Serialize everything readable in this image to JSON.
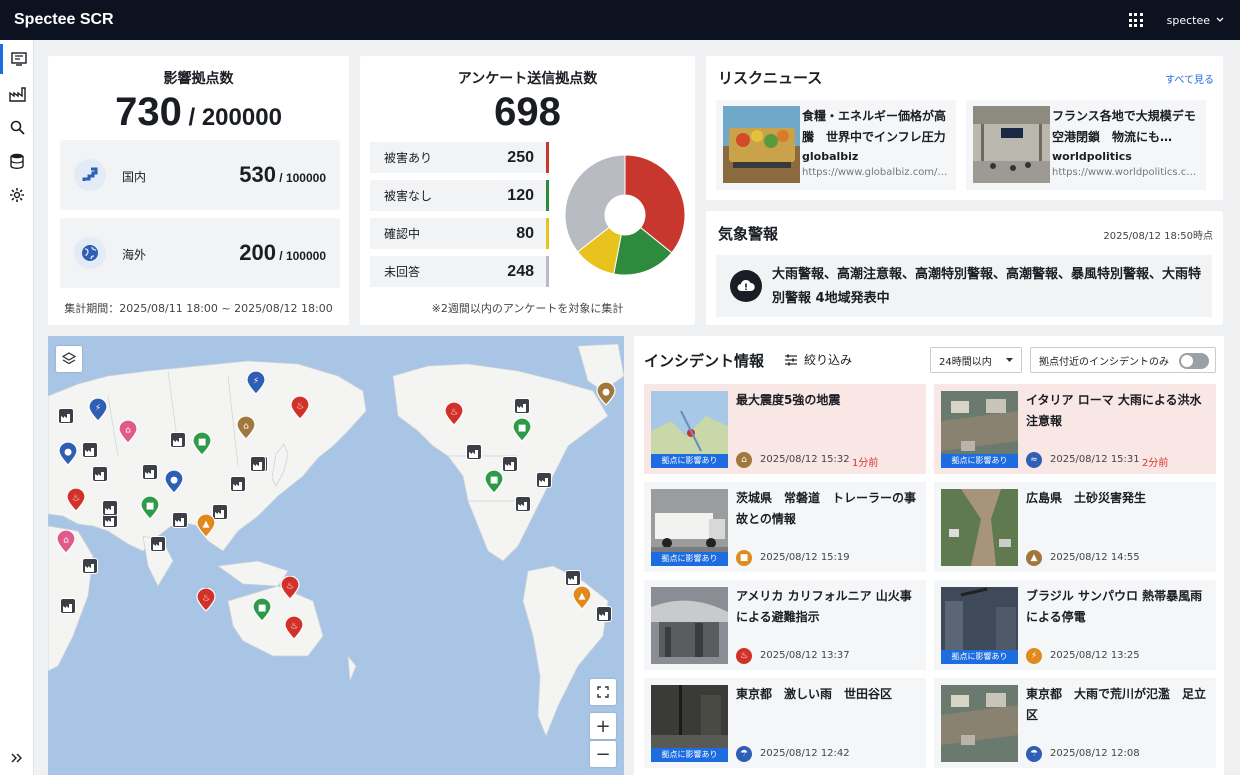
{
  "app": {
    "title": "Spectee SCR",
    "user": "spectee"
  },
  "sidebar": {
    "items": [
      {
        "name": "dashboard",
        "icon": "dashboard-icon"
      },
      {
        "name": "facilities",
        "icon": "factory-icon"
      },
      {
        "name": "search",
        "icon": "search-icon"
      },
      {
        "name": "database",
        "icon": "database-icon"
      },
      {
        "name": "settings",
        "icon": "gear-icon"
      }
    ],
    "expand_icon": "double-chevron-right-icon"
  },
  "impact": {
    "title": "影響拠点数",
    "count": "730",
    "total": " / 200000",
    "domestic": {
      "label": "国内",
      "value": "530",
      "total": " / 100000"
    },
    "overseas": {
      "label": "海外",
      "value": "200",
      "total": " / 100000"
    },
    "period": "集計期間：2025/08/11 18:00 ~ 2025/08/12 18:00"
  },
  "survey": {
    "title": "アンケート送信拠点数",
    "count": "698",
    "rows": [
      {
        "label": "被害あり",
        "value": "250",
        "color": "#c8372d"
      },
      {
        "label": "被害なし",
        "value": "120",
        "color": "#2e8b3e"
      },
      {
        "label": "確認中",
        "value": "80",
        "color": "#e8c21d"
      },
      {
        "label": "未回答",
        "value": "248",
        "color": "#b8bcc2"
      }
    ],
    "note": "※2週間以内のアンケートを対象に集計"
  },
  "risk_news": {
    "title": "リスクニュース",
    "see_all": "すべて見る",
    "items": [
      {
        "title": "食糧・エネルギー価格が高騰　世界中でインフレ圧力",
        "source": "globalbiz",
        "url": "https://www.globalbiz.com/news/inflation"
      },
      {
        "title": "フランス各地で大規模デモ　空港閉鎖　物流にも…",
        "source": "worldpolitics",
        "url": "https://www.worldpolitics.com/france"
      }
    ]
  },
  "weather": {
    "title": "気象警報",
    "timestamp": "2025/08/12 18:50時点",
    "alert": "大雨警報、高潮注意報、高潮特別警報、高潮警報、暴風特別警報、大雨特別警報 4地域発表中",
    "icon": "exclamation-cloud-icon"
  },
  "incidents": {
    "title": "インシデント情報",
    "filter_label": "絞り込み",
    "range": "24時間以内",
    "nearby_only": "拠点付近のインシデントのみ",
    "badge": "拠点に影響あり",
    "items": [
      {
        "title": "最大震度5強の地震",
        "time": "2025/08/12 15:32",
        "ago": "1分前",
        "icon": "house-icon",
        "icon_color": "#a0783c",
        "badge": true,
        "highlight": true
      },
      {
        "title": "イタリア ローマ 大雨による洪水注意報",
        "time": "2025/08/12 15:31",
        "ago": "2分前",
        "icon": "flood-icon",
        "icon_color": "#2f5fb5",
        "badge": true,
        "highlight": true
      },
      {
        "title": "茨城県　常磐道　トレーラーの事故との情報",
        "time": "2025/08/12 15:19",
        "ago": "",
        "icon": "accident-icon",
        "icon_color": "#e08a1e",
        "badge": true,
        "highlight": false
      },
      {
        "title": "広島県　土砂災害発生",
        "time": "2025/08/12 14:55",
        "ago": "",
        "icon": "landslide-icon",
        "icon_color": "#a0783c",
        "badge": false,
        "highlight": false
      },
      {
        "title": "アメリカ カリフォルニア 山火事による避難指示",
        "time": "2025/08/12 13:37",
        "ago": "",
        "icon": "fire-icon",
        "icon_color": "#d2312a",
        "badge": false,
        "highlight": false
      },
      {
        "title": "ブラジル サンパウロ 熱帯暴風雨による停電",
        "time": "2025/08/12 13:25",
        "ago": "",
        "icon": "outage-icon",
        "icon_color": "#e08a1e",
        "badge": true,
        "highlight": false
      },
      {
        "title": "東京都　激しい雨　世田谷区",
        "time": "2025/08/12 12:42",
        "ago": "",
        "icon": "rain-icon",
        "icon_color": "#2f5fb5",
        "badge": true,
        "highlight": false
      },
      {
        "title": "東京都　大雨で荒川が氾濫　足立区",
        "time": "2025/08/12 12:08",
        "ago": "",
        "icon": "rain-icon",
        "icon_color": "#2f5fb5",
        "badge": false,
        "highlight": false
      }
    ]
  },
  "map": {
    "layers_icon": "layers-icon",
    "fullscreen_icon": "fullscreen-icon",
    "zoom_in": "+",
    "zoom_out": "−"
  }
}
